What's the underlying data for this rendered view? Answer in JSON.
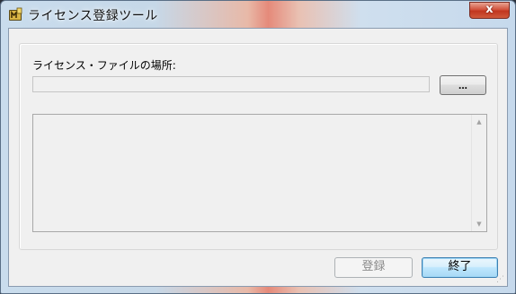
{
  "window": {
    "title": "ライセンス登録ツール",
    "close_label": "x",
    "accent_color": "#c1361f"
  },
  "form": {
    "file_label": "ライセンス・ファイルの場所:",
    "path_value": "",
    "browse_label": "...",
    "log_text": ""
  },
  "footer": {
    "register_label": "登録",
    "exit_label": "終了"
  },
  "icons": {
    "app": "app-icon",
    "close": "close-icon",
    "scroll_up": "scroll-up-icon",
    "scroll_down": "scroll-down-icon"
  }
}
